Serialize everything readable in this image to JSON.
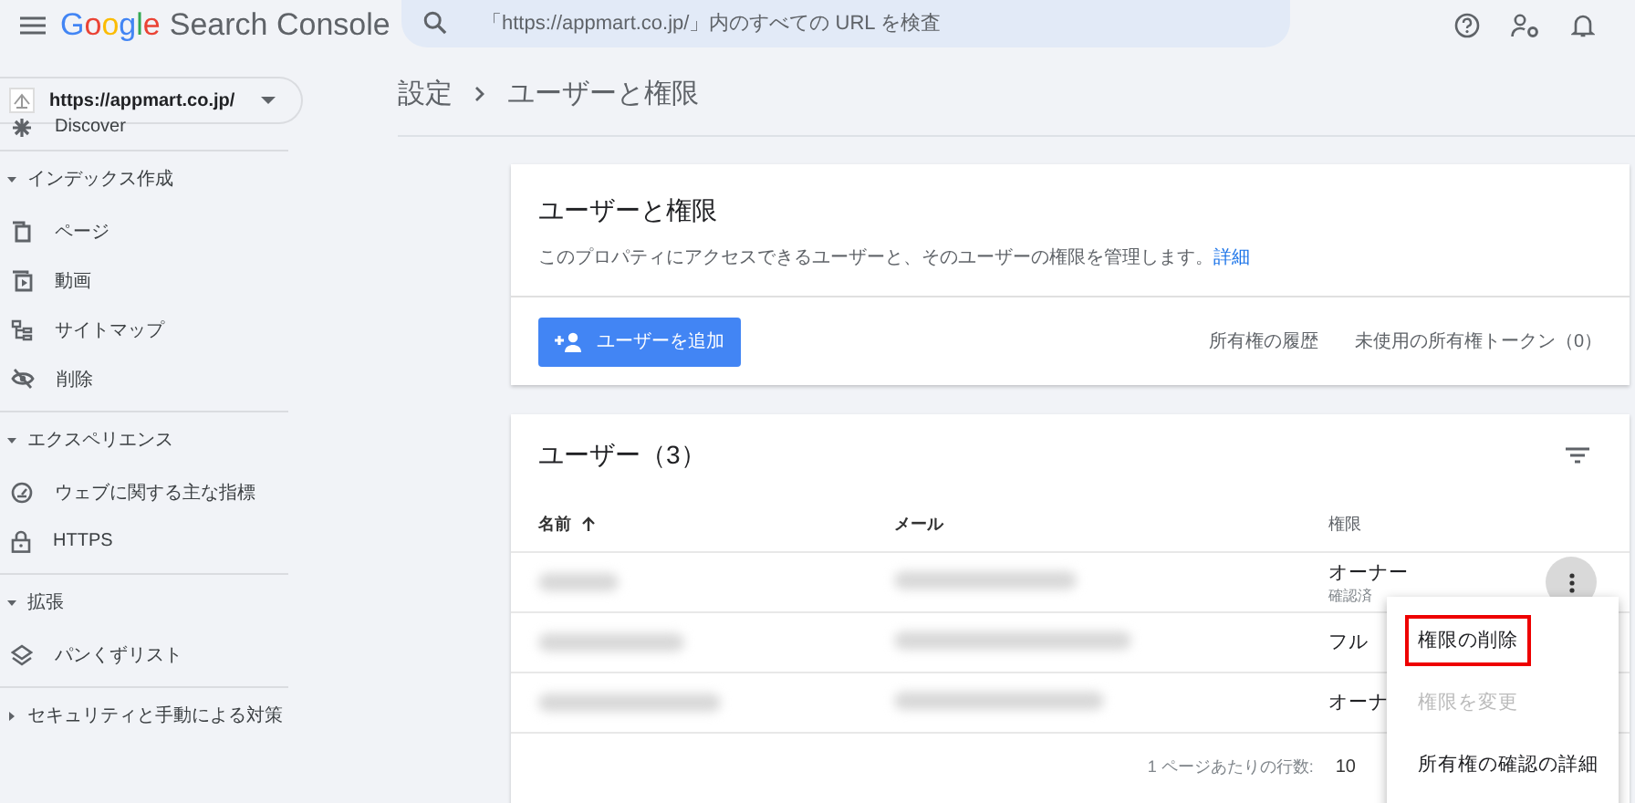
{
  "app": {
    "logo_google": "Google",
    "logo_product": "Search Console"
  },
  "search": {
    "placeholder": "「https://appmart.co.jp/」内のすべての URL を検査"
  },
  "property": {
    "label": "https://appmart.co.jp/"
  },
  "sidebar": {
    "items": [
      {
        "kind": "item",
        "label": "Discover"
      }
    ],
    "sections": [
      {
        "label": "インデックス作成",
        "expanded": true,
        "items": [
          {
            "label": "ページ"
          },
          {
            "label": "動画"
          },
          {
            "label": "サイトマップ"
          },
          {
            "label": "削除"
          }
        ]
      },
      {
        "label": "エクスペリエンス",
        "expanded": true,
        "items": [
          {
            "label": "ウェブに関する主な指標"
          },
          {
            "label": "HTTPS"
          }
        ]
      },
      {
        "label": "拡張",
        "expanded": true,
        "items": [
          {
            "label": "パンくずリスト"
          }
        ]
      },
      {
        "label": "セキュリティと手動による対策",
        "expanded": false
      }
    ]
  },
  "breadcrumb": [
    "設定",
    "ユーザーと権限"
  ],
  "intro_card": {
    "title": "ユーザーと権限",
    "description": "このプロパティにアクセスできるユーザーと、そのユーザーの権限を管理します。",
    "link": "詳細",
    "add_button": "ユーザーを追加",
    "links": [
      "所有権の履歴",
      "未使用の所有権トークン（0）"
    ]
  },
  "users_card": {
    "title": "ユーザー（3）",
    "columns": [
      "名前",
      "メール",
      "権限"
    ],
    "rows": [
      {
        "permission": "オーナー",
        "note": "確認済"
      },
      {
        "permission": "フル"
      },
      {
        "permission": "オーナ"
      }
    ],
    "rows_per_page_label": "1 ページあたりの行数:",
    "rows_per_page": "10"
  },
  "menu": {
    "items": [
      {
        "label": "権限の削除",
        "disabled": false,
        "highlighted": true
      },
      {
        "label": "権限を変更",
        "disabled": true,
        "highlighted": false
      },
      {
        "label": "所有権の確認の詳細",
        "disabled": false,
        "highlighted": false
      }
    ]
  }
}
